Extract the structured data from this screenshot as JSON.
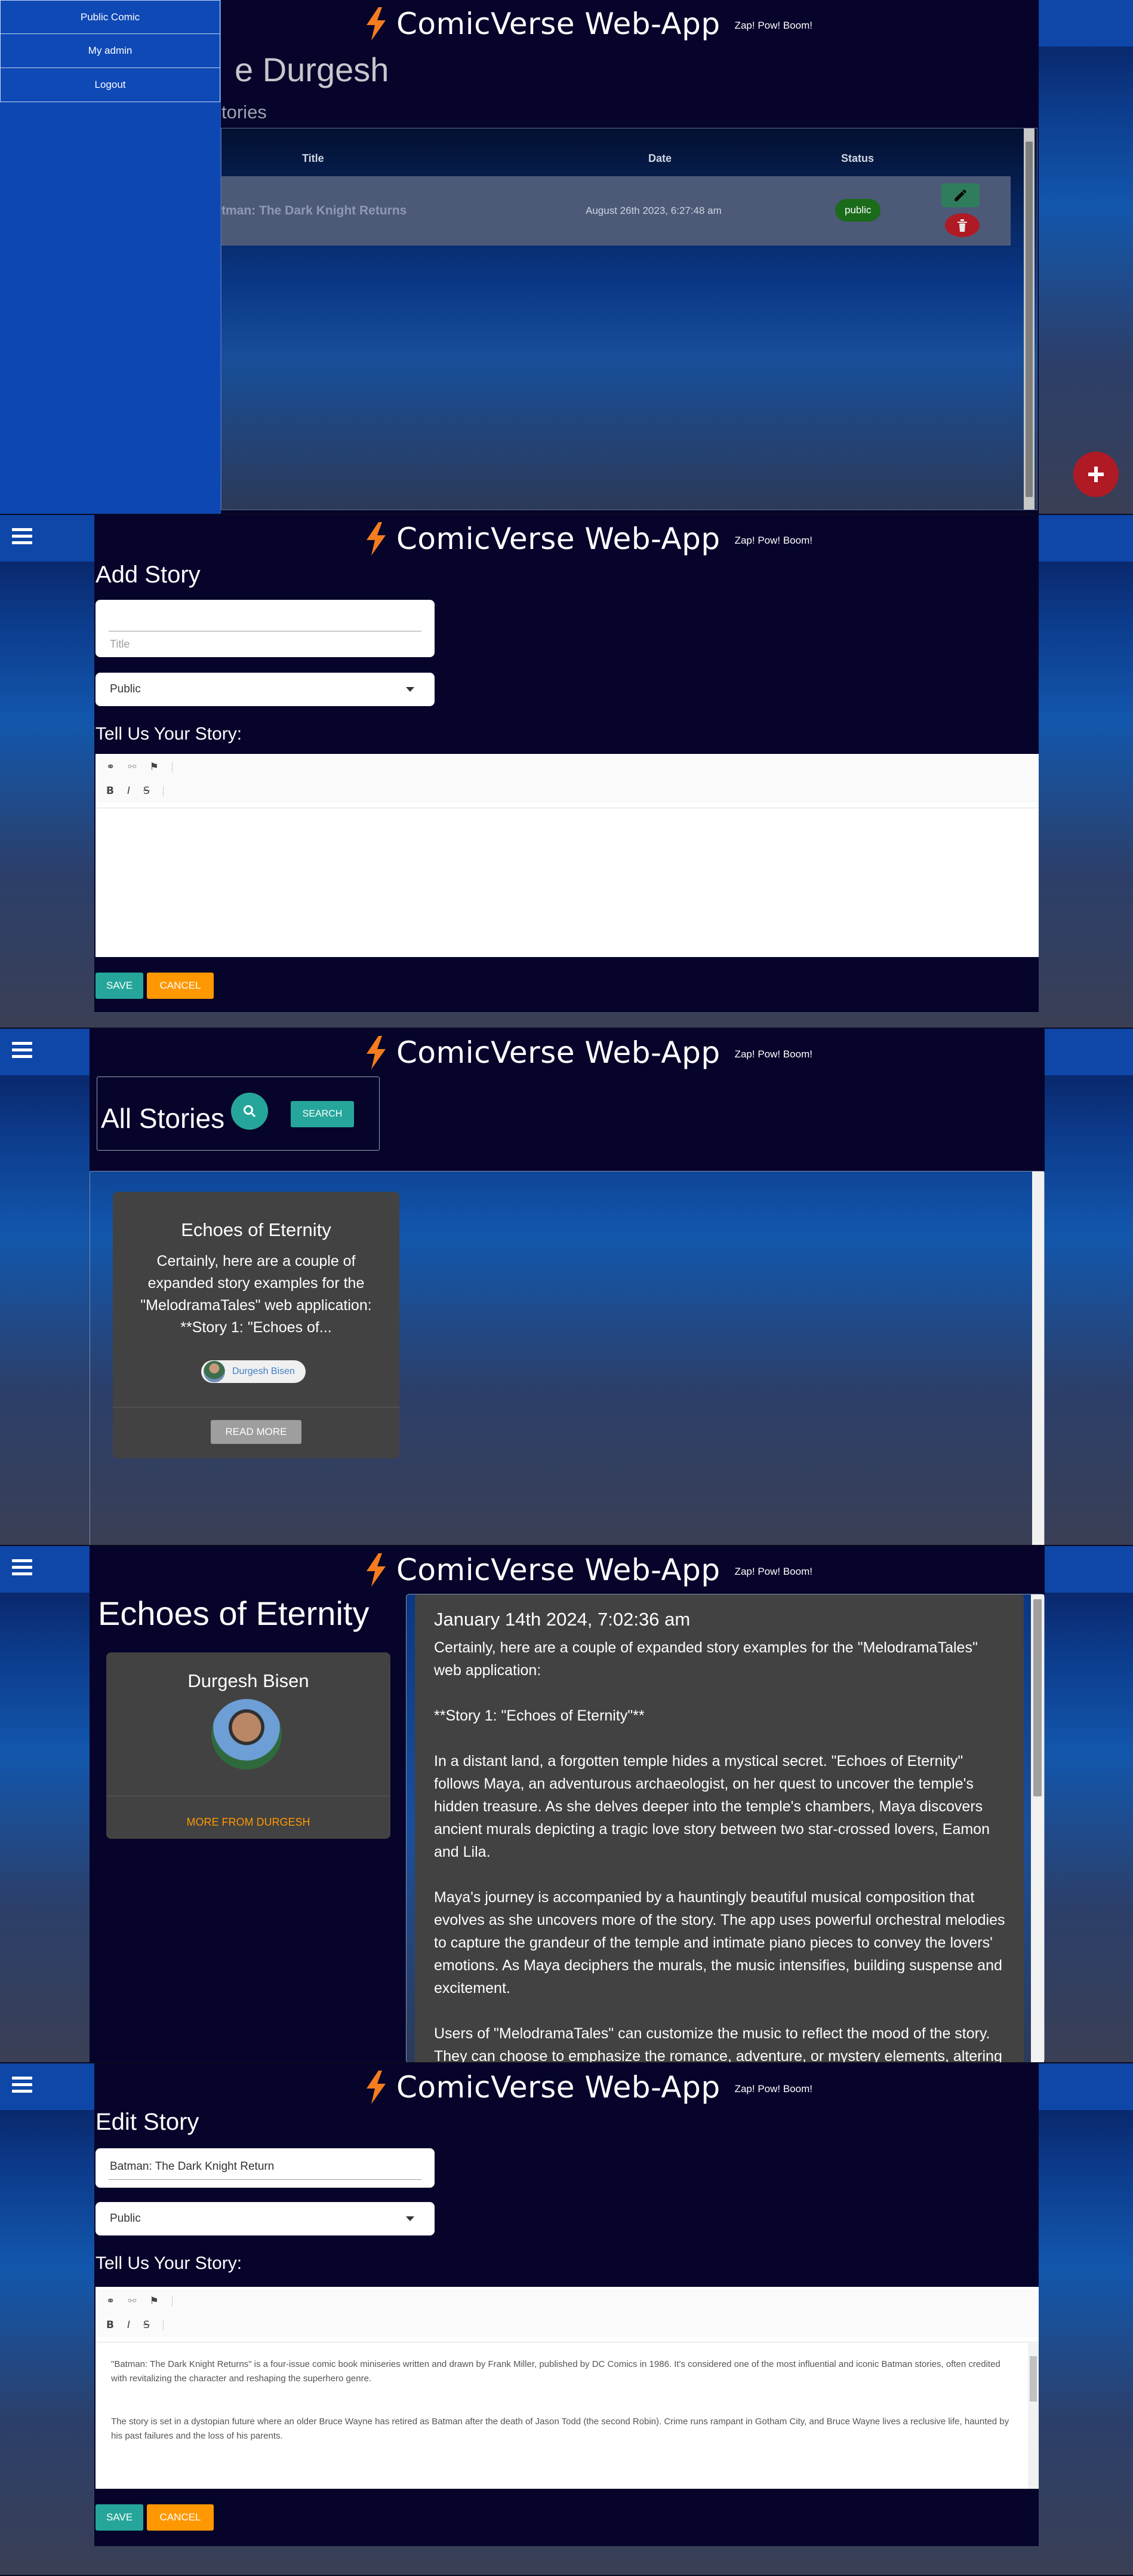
{
  "brand": {
    "title": "ComicVerse Web-App",
    "subtitle": "Zap! Pow! Boom!"
  },
  "panel1": {
    "drawer": [
      "Public Comic",
      "My admin",
      "Logout"
    ],
    "heading": "e Durgesh",
    "subheading": "tories",
    "table": {
      "headers": [
        "Title",
        "Date",
        "Status"
      ],
      "rows": [
        {
          "title": "tman: The Dark Knight Returns",
          "date": "August 26th 2023, 6:27:48 am",
          "status": "public"
        }
      ]
    }
  },
  "add_story": {
    "heading": "Add Story",
    "title_placeholder": "Title",
    "visibility": "Public",
    "story_label": "Tell Us Your Story:",
    "save": "SAVE",
    "cancel": "CANCEL"
  },
  "all_stories": {
    "heading": "All Stories",
    "search": "SEARCH",
    "cards": [
      {
        "title": "Echoes of Eternity",
        "excerpt": "Certainly, here are a couple of expanded story examples for the \"MelodramaTales\" web application: **Story 1: \"Echoes of...",
        "author": "Durgesh Bisen",
        "action": "READ MORE"
      }
    ]
  },
  "story_detail": {
    "title": "Echoes of Eternity",
    "author": "Durgesh Bisen",
    "more_link": "MORE FROM DURGESH",
    "date": "January 14th 2024, 7:02:36 am",
    "paragraphs": [
      "Certainly, here are a couple of expanded story examples for the \"MelodramaTales\" web application:",
      "**Story 1: \"Echoes of Eternity\"**",
      "In a distant land, a forgotten temple hides a mystical secret. \"Echoes of Eternity\" follows Maya, an adventurous archaeologist, on her quest to uncover the temple's hidden treasure. As she delves deeper into the temple's chambers, Maya discovers ancient murals depicting a tragic love story between two star-crossed lovers, Eamon and Lila.",
      "Maya's journey is accompanied by a hauntingly beautiful musical composition that evolves as she uncovers more of the story. The app uses powerful orchestral melodies to capture the grandeur of the temple and intimate piano pieces to convey the lovers' emotions. As Maya deciphers the murals, the music intensifies, building suspense and excitement.",
      "Users of \"MelodramaTales\" can customize the music to reflect the mood of the story. They can choose to emphasize the romance, adventure, or mystery elements, altering"
    ]
  },
  "edit_story": {
    "heading": "Edit Story",
    "title_value": "Batman: The Dark Knight Return",
    "visibility": "Public",
    "story_label": "Tell Us Your Story:",
    "body": [
      "\"Batman: The Dark Knight Returns\" is a four-issue comic book miniseries written and drawn by Frank Miller, published by DC Comics in 1986. It's considered one of the most influential and iconic Batman stories, often credited with revitalizing the character and reshaping the superhero genre.",
      "The story is set in a dystopian future where an older Bruce Wayne has retired as Batman after the death of Jason Todd (the second Robin). Crime runs rampant in Gotham City, and Bruce Wayne lives a reclusive life, haunted by his past failures and the loss of his parents."
    ],
    "save": "SAVE",
    "cancel": "CANCEL"
  },
  "colors": {
    "nav_blue": "#0e47a8",
    "dark_navy": "#06042a",
    "teal": "#26a69a",
    "orange": "#ff9800",
    "bolt": "#f57c1f",
    "public_green": "#1a6b1a",
    "fab_red": "#b01a25"
  }
}
